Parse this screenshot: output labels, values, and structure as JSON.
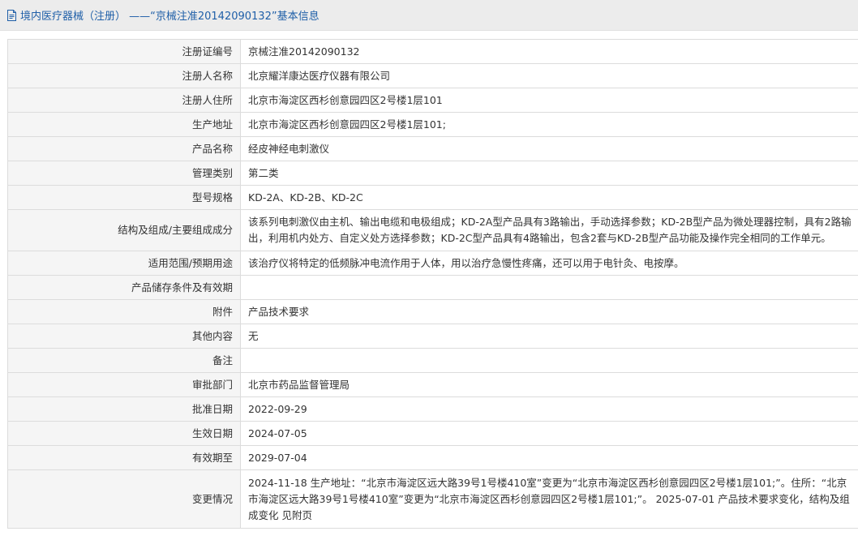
{
  "header": {
    "title": "境内医疗器械（注册）  ——“京械注准20142090132”基本信息",
    "icon": "document-icon",
    "color": "#1f5fa8"
  },
  "rows": [
    {
      "key": "registration-number",
      "label": "注册证编号",
      "value": "京械注准20142090132"
    },
    {
      "key": "registrant-name",
      "label": "注册人名称",
      "value": "北京耀洋康达医疗仪器有限公司"
    },
    {
      "key": "registrant-address",
      "label": "注册人住所",
      "value": "北京市海淀区西杉创意园四区2号楼1层101"
    },
    {
      "key": "production-address",
      "label": "生产地址",
      "value": "北京市海淀区西杉创意园四区2号楼1层101;"
    },
    {
      "key": "product-name",
      "label": "产品名称",
      "value": "经皮神经电刺激仪"
    },
    {
      "key": "management-class",
      "label": "管理类别",
      "value": "第二类"
    },
    {
      "key": "model-spec",
      "label": "型号规格",
      "value": "KD-2A、KD-2B、KD-2C"
    },
    {
      "key": "structure",
      "label": "结构及组成/主要组成成分",
      "value": "该系列电刺激仪由主机、输出电缆和电极组成；KD-2A型产品具有3路输出，手动选择参数；KD-2B型产品为微处理器控制，具有2路输出，利用机内处方、自定义处方选择参数；KD-2C型产品具有4路输出，包含2套与KD-2B型产品功能及操作完全相同的工作单元。"
    },
    {
      "key": "intended-use",
      "label": "适用范围/预期用途",
      "value": "该治疗仪将特定的低频脉冲电流作用于人体，用以治疗急慢性疼痛，还可以用于电针灸、电按摩。"
    },
    {
      "key": "storage",
      "label": "产品储存条件及有效期",
      "value": ""
    },
    {
      "key": "attachment",
      "label": "附件",
      "value": "产品技术要求"
    },
    {
      "key": "other",
      "label": "其他内容",
      "value": "无"
    },
    {
      "key": "remarks",
      "label": "备注",
      "value": ""
    },
    {
      "key": "approval-dept",
      "label": "审批部门",
      "value": "北京市药品监督管理局"
    },
    {
      "key": "approval-date",
      "label": "批准日期",
      "value": "2022-09-29"
    },
    {
      "key": "effective-date",
      "label": "生效日期",
      "value": "2024-07-05"
    },
    {
      "key": "expiry-date",
      "label": "有效期至",
      "value": "2029-07-04"
    },
    {
      "key": "change-history",
      "label": "变更情况",
      "value": "2024-11-18 生产地址：“北京市海淀区远大路39号1号楼410室”变更为“北京市海淀区西杉创意园四区2号楼1层101;”。住所：“北京市海淀区远大路39号1号楼410室”变更为“北京市海淀区西杉创意园四区2号楼1层101;”。 2025-07-01 产品技术要求变化，结构及组成变化 见附页"
    }
  ]
}
